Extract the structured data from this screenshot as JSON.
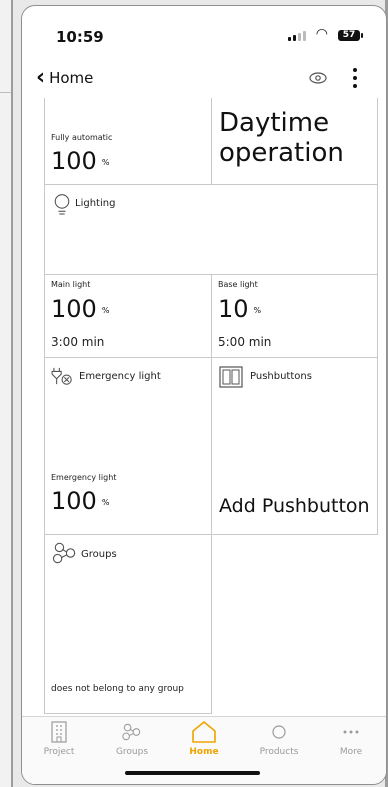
{
  "status_bar": {
    "time": "10:59",
    "battery": "57"
  },
  "nav": {
    "back_label": "Home"
  },
  "cells": {
    "fully_automatic": {
      "label": "Fully automatic",
      "value": "100",
      "unit": "%"
    },
    "daytime": {
      "line1": "Daytime",
      "line2": "operation"
    },
    "lighting": {
      "title": "Lighting"
    },
    "main_light": {
      "label": "Main light",
      "value": "100",
      "unit": "%",
      "time": "3:00 min"
    },
    "base_light": {
      "label": "Base light",
      "value": "10",
      "unit": "%",
      "time": "5:00 min"
    },
    "emergency": {
      "title": "Emergency light",
      "label": "Emergency light",
      "value": "100",
      "unit": "%"
    },
    "pushbuttons": {
      "title": "Pushbuttons",
      "action": "Add Pushbutton"
    },
    "groups": {
      "title": "Groups",
      "status": "does not belong to any group"
    }
  },
  "tabs": [
    {
      "label": "Project",
      "icon": "project-icon"
    },
    {
      "label": "Groups",
      "icon": "groups-icon"
    },
    {
      "label": "Home",
      "icon": "home-icon"
    },
    {
      "label": "Products",
      "icon": "products-icon"
    },
    {
      "label": "More",
      "icon": "more-icon"
    }
  ],
  "colors": {
    "accent": "#f0a400",
    "inactive": "#9a9a9a",
    "border": "#c9c9c9"
  }
}
